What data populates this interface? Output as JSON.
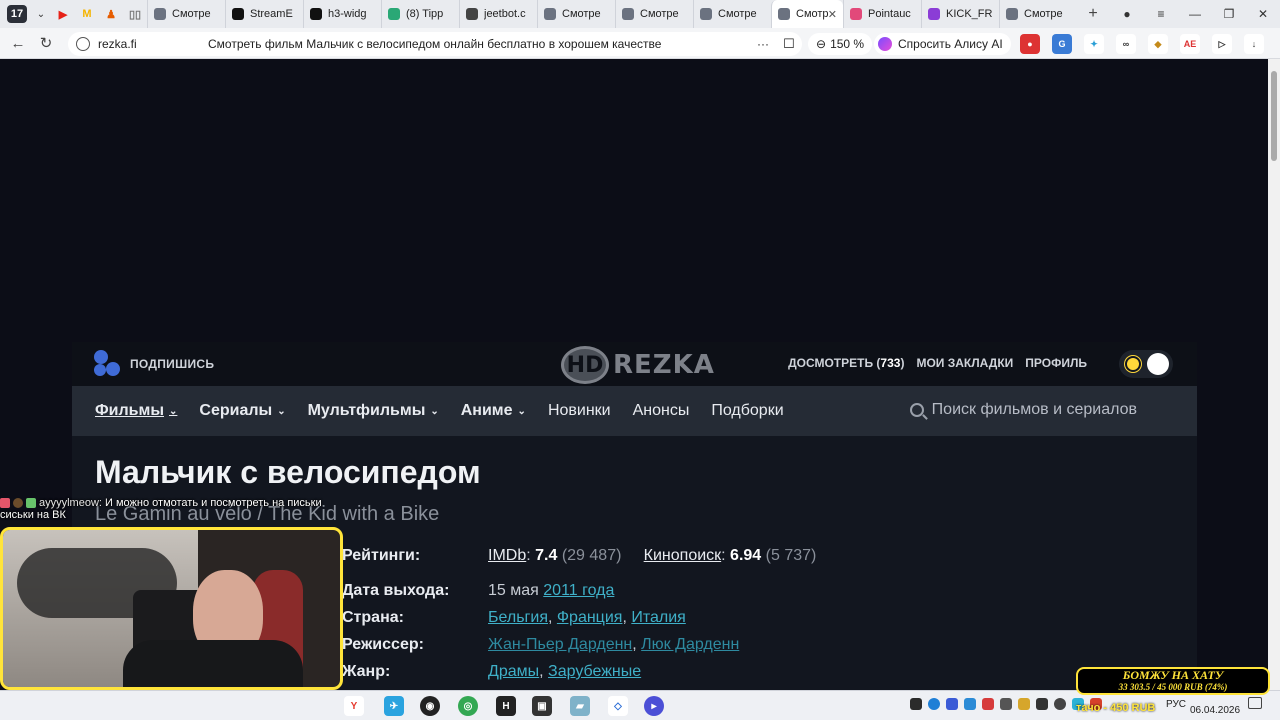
{
  "browser": {
    "tab_count": "17",
    "tabs": [
      {
        "title": "Смотре",
        "color": "#6b7280"
      },
      {
        "title": "StreamE",
        "color": "#111"
      },
      {
        "title": "h3-widg",
        "color": "#111"
      },
      {
        "title": "(8) Tipp",
        "color": "#2aa876"
      },
      {
        "title": "jeetbot.c",
        "color": "#444"
      },
      {
        "title": "Смотре",
        "color": "#6b7280"
      },
      {
        "title": "Смотре",
        "color": "#6b7280"
      },
      {
        "title": "Смотре",
        "color": "#6b7280"
      },
      {
        "title": "Смотр",
        "color": "#6b7280",
        "active": true
      },
      {
        "title": "Pointauc",
        "color": "#e2497a"
      },
      {
        "title": "KICK_FR",
        "color": "#8b3dd6"
      },
      {
        "title": "Смотре",
        "color": "#6b7280"
      }
    ],
    "url_domain": "rezka.fi",
    "page_title": "Смотреть фильм Мальчик с велосипедом онлайн бесплатно в хорошем качестве",
    "zoom": "150 %",
    "alisa": "Спросить Алису AI"
  },
  "site": {
    "subscribe": "ПОДПИШИСЬ",
    "logo_hd": "HD",
    "logo_rezka": "REZKA",
    "watch_label": "ДОСМОТРЕТЬ (",
    "watch_count": "733",
    "watch_close": ")",
    "bookmarks": "МОИ ЗАКЛАДКИ",
    "profile": "ПРОФИЛЬ",
    "nav": {
      "films": "Фильмы",
      "series": "Сериалы",
      "cartoons": "Мультфильмы",
      "anime": "Аниме",
      "new": "Новинки",
      "announcements": "Анонсы",
      "collections": "Подборки"
    },
    "search_placeholder": "Поиск фильмов и сериалов",
    "movie": {
      "title": "Мальчик с велосипедом",
      "original": "Le Gamin au vélo / The Kid with a Bike",
      "ratings_label": "Рейтинги:",
      "imdb_name": "IMDb",
      "imdb_score": "7.4",
      "imdb_votes": "(29 487)",
      "kp_name": "Кинопоиск",
      "kp_score": "6.94",
      "kp_votes": "(5 737)",
      "release_label": "Дата выхода:",
      "release_day": "15 мая",
      "release_year": "2011 года",
      "country_label": "Страна:",
      "countries": [
        "Бельгия",
        "Франция",
        "Италия"
      ],
      "director_label": "Режиссер:",
      "directors": [
        "Жан-Пьер Дарденн",
        "Люк Дарденн"
      ],
      "genre_label": "Жанр:",
      "genres": [
        "Драмы",
        "Зарубежные"
      ]
    }
  },
  "stream": {
    "chat_nick": "ayyyylmeow:",
    "chat_msg": "И можно отмотать и посмотреть на письки",
    "chat_msg2": "сиськи на ВК",
    "donate_line1": "БОМЖУ НА ХАТУ",
    "donate_line2": "33 303.5 / 45 000 RUB (74%)",
    "donate_ticker": "тачо - 450 RUB"
  },
  "taskbar": {
    "lang": "РУС",
    "date": "06.04.2026"
  }
}
